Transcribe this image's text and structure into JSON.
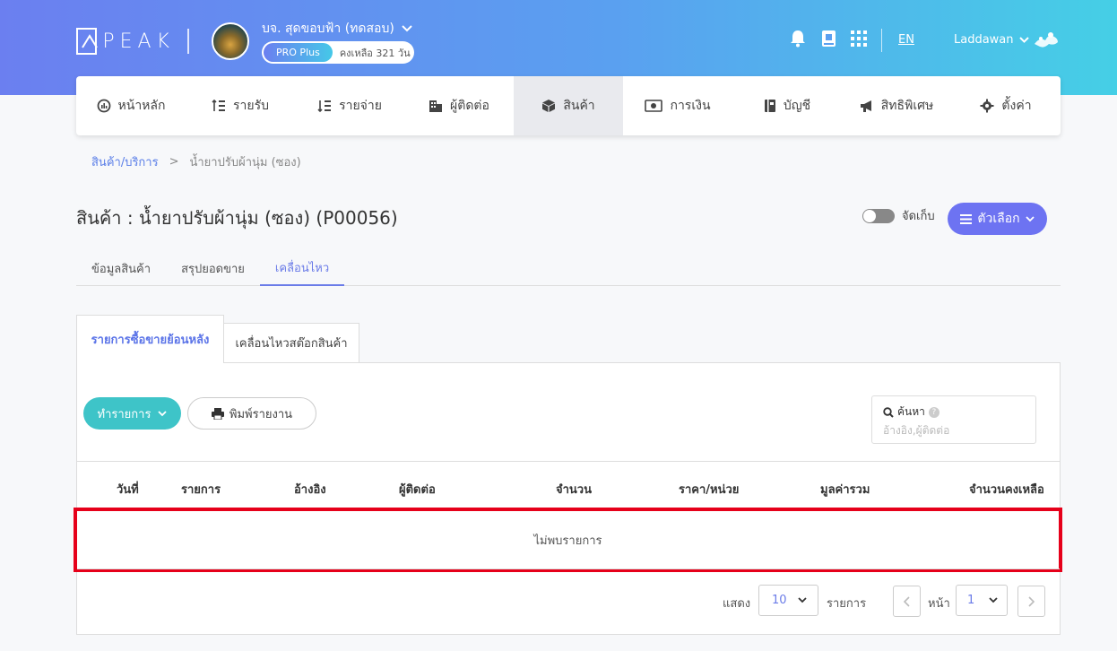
{
  "header": {
    "logo_text": "PEAK",
    "company_name": "บจ. สุดขอบฟ้า (ทดสอบ)",
    "plan_badge": "PRO Plus",
    "plan_days": "คงเหลือ 321 วัน",
    "language": "EN",
    "username": "Laddawan",
    "icons": [
      "bell-icon",
      "book-icon",
      "grid-icon"
    ]
  },
  "nav": {
    "items": [
      {
        "label": "หน้าหลัก",
        "icon": "dashboard-icon"
      },
      {
        "label": "รายรับ",
        "icon": "income-icon"
      },
      {
        "label": "รายจ่าย",
        "icon": "expense-icon"
      },
      {
        "label": "ผู้ติดต่อ",
        "icon": "contacts-icon"
      },
      {
        "label": "สินค้า",
        "icon": "box-icon",
        "active": true
      },
      {
        "label": "การเงิน",
        "icon": "money-icon"
      },
      {
        "label": "บัญชี",
        "icon": "ledger-icon"
      },
      {
        "label": "สิทธิพิเศษ",
        "icon": "megaphone-icon"
      },
      {
        "label": "ตั้งค่า",
        "icon": "gear-icon"
      }
    ]
  },
  "breadcrumb": {
    "root": "สินค้า/บริการ",
    "separator": ">",
    "current": "น้ำยาปรับผ้านุ่ม (ซอง)"
  },
  "page": {
    "title": "สินค้า : น้ำยาปรับผ้านุ่ม (ซอง) (P00056)",
    "archive_label": "จัดเก็บ",
    "options_label": "ตัวเลือก"
  },
  "main_tabs": [
    {
      "label": "ข้อมูลสินค้า"
    },
    {
      "label": "สรุปยอดขาย"
    },
    {
      "label": "เคลื่อนไหว",
      "active": true
    }
  ],
  "sub_tabs": {
    "tab1": "รายการซื้อขายย้อนหลัง",
    "tab2": "เคลื่อนไหวสต๊อกสินค้า"
  },
  "toolbar": {
    "action_label": "ทำรายการ",
    "print_label": "พิมพ์รายงาน",
    "search_label": "ค้นหา",
    "search_placeholder": "อ้างอิง,ผู้ติดต่อ",
    "help_mark": "?"
  },
  "table": {
    "columns": [
      "วันที่",
      "รายการ",
      "อ้างอิง",
      "ผู้ติดต่อ",
      "จำนวน",
      "ราคา/หน่วย",
      "มูลค่ารวม",
      "จำนวนคงเหลือ"
    ],
    "empty_text": "ไม่พบรายการ"
  },
  "pager": {
    "show_label": "แสดง",
    "page_size": "10",
    "items_label": "รายการ",
    "page_label": "หน้า",
    "page": "1"
  },
  "colors": {
    "accent": "#6d73f2",
    "teal": "#3ec4c8",
    "highlight": "#e6001a"
  }
}
